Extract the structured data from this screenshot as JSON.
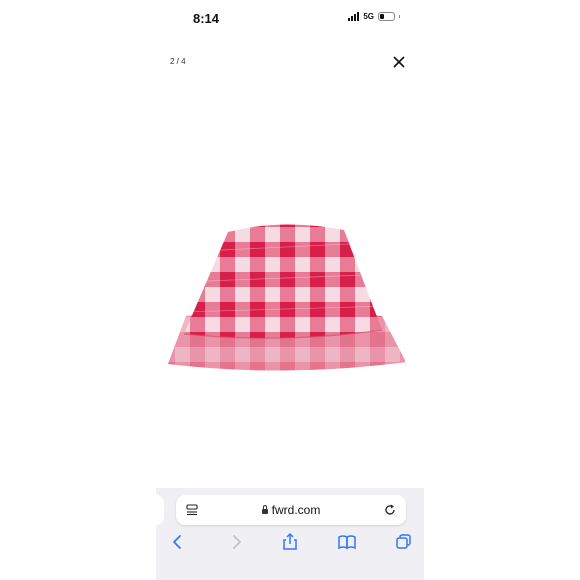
{
  "status_bar": {
    "time": "8:14",
    "network": "5G",
    "battery_level": 0.3
  },
  "gallery": {
    "counter": "2 / 4",
    "close_icon": "close-icon",
    "image_icon": "bucket-hat-image"
  },
  "browser": {
    "url": "fwrd.com",
    "accent_color": "#3478f6",
    "icons": [
      "tab-settings-icon",
      "lock-icon",
      "reload-icon",
      "back-icon",
      "forward-icon",
      "share-icon",
      "bookmarks-icon",
      "tabs-icon"
    ]
  }
}
